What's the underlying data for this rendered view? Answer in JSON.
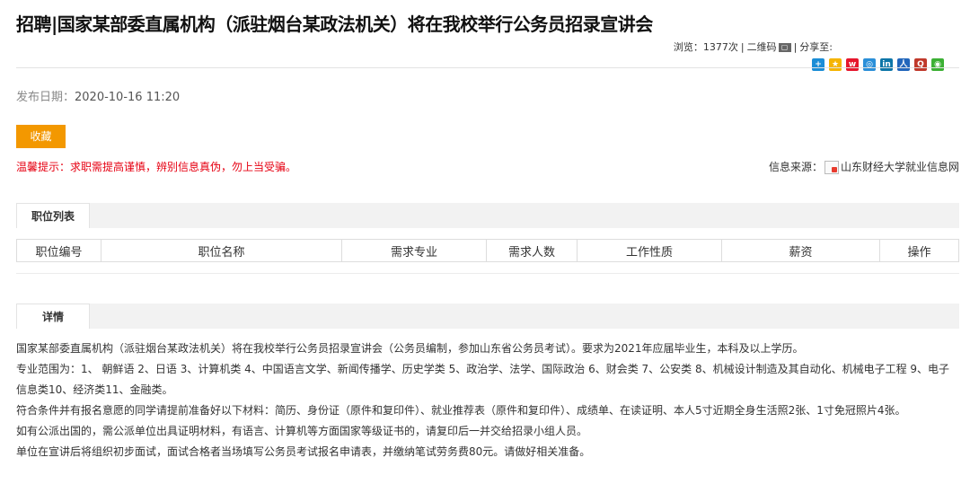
{
  "page": {
    "title": "招聘|国家某部委直属机构（派驻烟台某政法机关）将在我校举行公务员招录宣讲会",
    "views_label": "浏览：1377次",
    "qr_label": "二维码",
    "share_label": "分享至:",
    "share_icons": [
      {
        "name": "share-plus-icon",
        "color": "#1a8dd6",
        "glyph": "+"
      },
      {
        "name": "qzone-icon",
        "color": "#f5b400",
        "glyph": "★"
      },
      {
        "name": "weibo-icon",
        "color": "#e6162d",
        "glyph": "w"
      },
      {
        "name": "tencent-weibo-icon",
        "color": "#2b8fd8",
        "glyph": "◎"
      },
      {
        "name": "linkedin-icon",
        "color": "#0e76a8",
        "glyph": "in"
      },
      {
        "name": "renren-icon",
        "color": "#2266bb",
        "glyph": "人"
      },
      {
        "name": "qq-icon",
        "color": "#c0392b",
        "glyph": "Q"
      },
      {
        "name": "wechat-icon",
        "color": "#3cb034",
        "glyph": "◉"
      }
    ]
  },
  "publish": {
    "label": "发布日期：",
    "value": "2020-10-16 11:20"
  },
  "favorite_button": "收藏",
  "warning": "温馨提示：求职需提高谨慎，辨别信息真伪，勿上当受骗。",
  "source": {
    "label": "信息来源：",
    "name": "山东财经大学就业信息网"
  },
  "positions_tab": "职位列表",
  "positions_table": {
    "headers": [
      "职位编号",
      "职位名称",
      "需求专业",
      "需求人数",
      "工作性质",
      "薪资",
      "操作"
    ]
  },
  "details_tab": "详情",
  "details": [
    "国家某部委直属机构（派驻烟台某政法机关）将在我校举行公务员招录宣讲会（公务员编制，参加山东省公务员考试）。要求为2021年应届毕业生，本科及以上学历。",
    "专业范围为：1、 朝鲜语 2、日语 3、计算机类 4、中国语言文学、新闻传播学、历史学类 5、政治学、法学、国际政治 6、财会类 7、公安类 8、机械设计制造及其自动化、机械电子工程 9、电子信息类10、经济类11、金融类。",
    "符合条件并有报名意愿的同学请提前准备好以下材料：简历、身份证（原件和复印件）、就业推荐表（原件和复印件）、成绩单、在读证明、本人5寸近期全身生活照2张、1寸免冠照片4张。",
    "如有公派出国的，需公派单位出具证明材料，有语言、计算机等方面国家等级证书的，请复印后一并交给招录小组人员。",
    "单位在宣讲后将组织初步面试，面试合格者当场填写公务员考试报名申请表，并缴纳笔试劳务费80元。请做好相关准备。"
  ]
}
